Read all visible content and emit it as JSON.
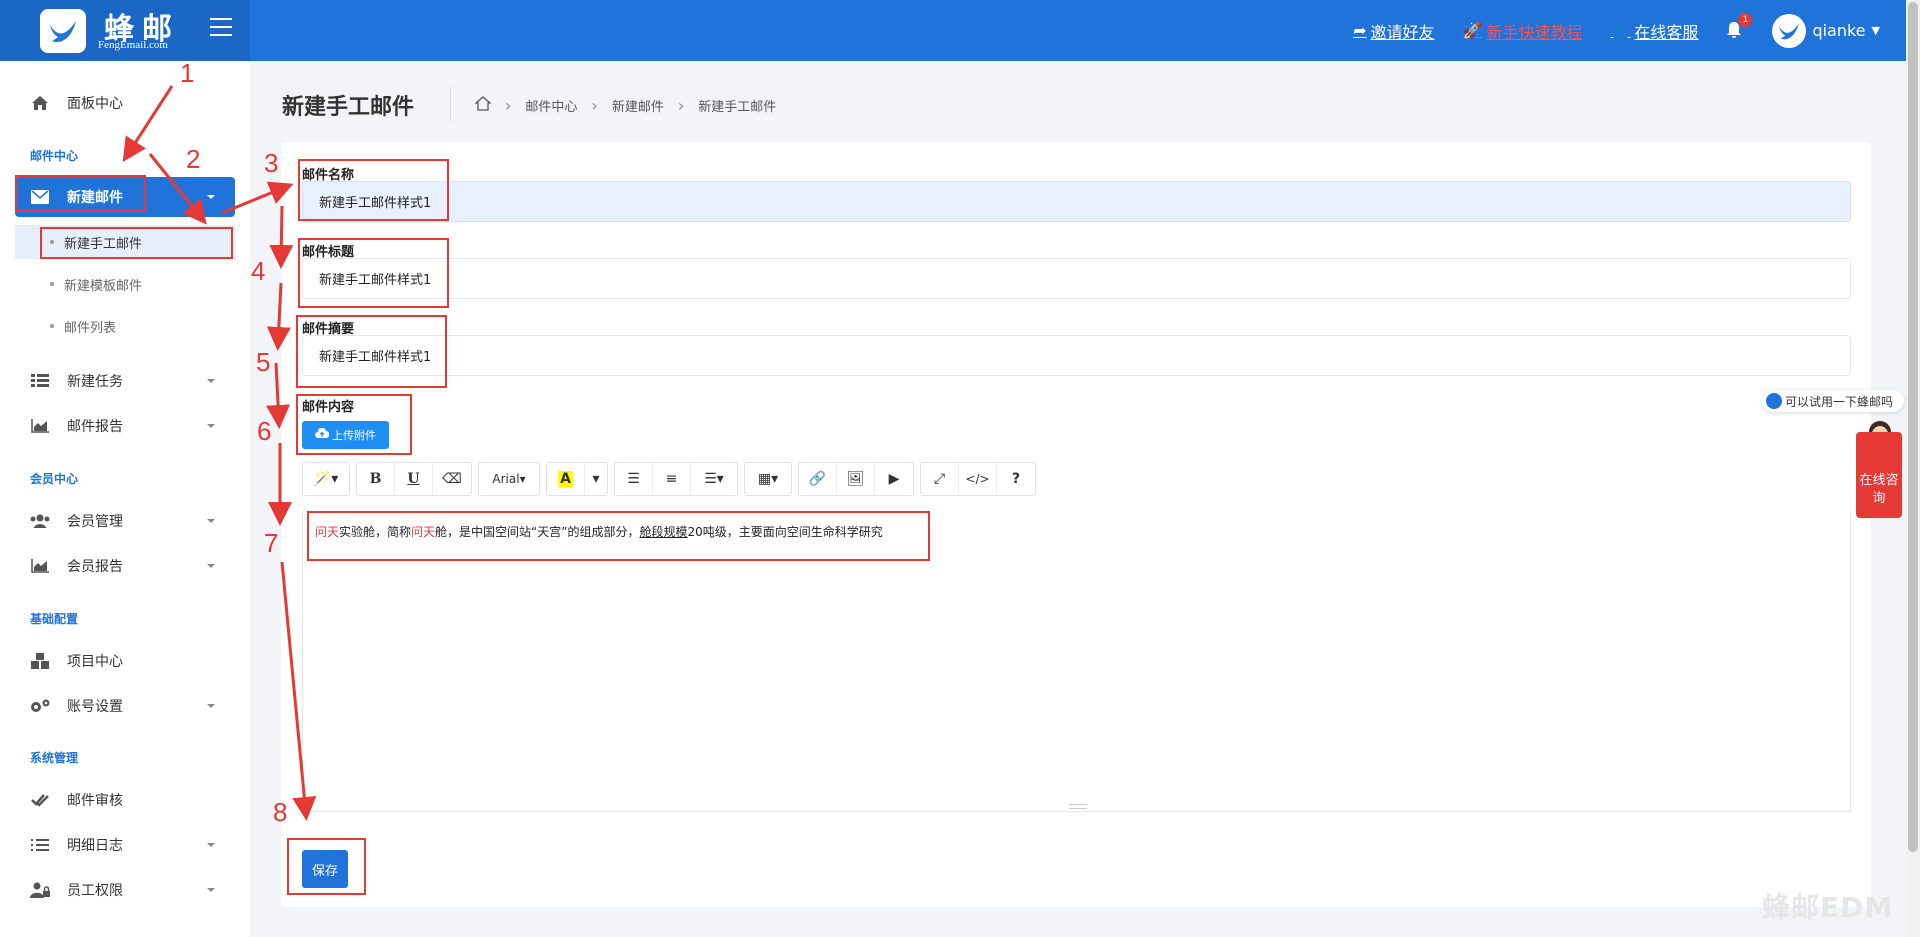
{
  "brand": {
    "name": "蜂邮",
    "subtitle": "FengEmail.com"
  },
  "header": {
    "links": [
      {
        "label": "邀请好友",
        "icon": "share-icon"
      },
      {
        "label": "新手快速教程",
        "icon": "rocket-icon"
      },
      {
        "label": "在线客服",
        "icon": "user-icon"
      }
    ],
    "notification_count": "1",
    "username": "qianke"
  },
  "sidebar": {
    "dashboard": "面板中心",
    "section_mail": "邮件中心",
    "new_mail": "新建邮件",
    "sub_manual": "新建手工邮件",
    "sub_template": "新建模板邮件",
    "sub_list": "邮件列表",
    "new_task": "新建任务",
    "mail_report": "邮件报告",
    "section_member": "会员中心",
    "member_manage": "会员管理",
    "member_report": "会员报告",
    "section_config": "基础配置",
    "project_center": "项目中心",
    "account_settings": "账号设置",
    "section_system": "系统管理",
    "mail_review": "邮件审核",
    "detail_log": "明细日志",
    "staff_perm": "员工权限"
  },
  "page": {
    "title": "新建手工邮件",
    "breadcrumb": [
      "邮件中心",
      "新建邮件",
      "新建手工邮件"
    ]
  },
  "form": {
    "name_label": "邮件名称",
    "name_value": "新建手工邮件样式1",
    "subject_label": "邮件标题",
    "subject_value": "新建手工邮件样式1",
    "summary_label": "邮件摘要",
    "summary_value": "新建手工邮件样式1",
    "content_label": "邮件内容",
    "upload_label": "上传附件",
    "font_name": "Arial",
    "content": {
      "p1": "问天",
      "p2": "实验舱，简称",
      "p3": "问天",
      "p4": "舱，是中国空间站“天宫”的组成部分，",
      "p5": "舱段规模",
      "p6": "20吨级，主要面向空间生命科学研究"
    },
    "save_label": "保存"
  },
  "annotations": [
    "1",
    "2",
    "3",
    "4",
    "5",
    "6",
    "7",
    "8"
  ],
  "floating": {
    "try_text": "可以试用一下蜂邮吗",
    "consult_text": "在线咨询",
    "watermark": "蜂邮EDM"
  },
  "colors": {
    "primary": "#1f73d9",
    "annotation": "#e53935"
  }
}
